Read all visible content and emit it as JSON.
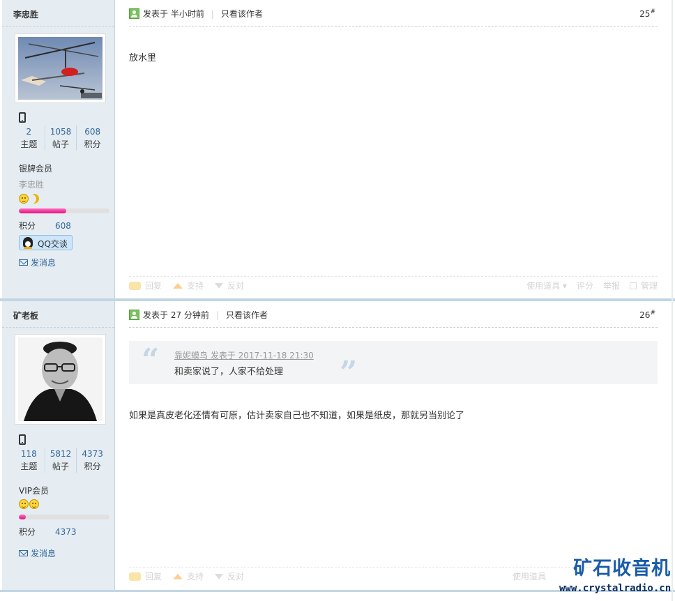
{
  "posts": [
    {
      "username": "李忠胜",
      "stats": [
        {
          "num": "2",
          "label": "主题"
        },
        {
          "num": "1058",
          "label": "帖子"
        },
        {
          "num": "608",
          "label": "积分"
        }
      ],
      "level": "银牌会员",
      "rank_name": "李忠胜",
      "points_label": "积分",
      "points_value": "608",
      "progress_fraction": 0.52,
      "qq_label": "QQ交谈",
      "message_label": "发消息",
      "posted_at": "发表于 半小时前",
      "only_author": "只看该作者",
      "floor": "25",
      "floor_mark": "#",
      "body": "放水里",
      "actions": {
        "reply": "回复",
        "support": "支持",
        "oppose": "反对",
        "tools": "使用道具",
        "rate": "评分",
        "report": "举报",
        "manage": "管理"
      }
    },
    {
      "username": "矿老板",
      "stats": [
        {
          "num": "118",
          "label": "主题"
        },
        {
          "num": "5812",
          "label": "帖子"
        },
        {
          "num": "4373",
          "label": "积分"
        }
      ],
      "level": "VIP会员",
      "points_label": "积分",
      "points_value": "4373",
      "progress_fraction": 0.08,
      "message_label": "发消息",
      "posted_at": "发表于 27 分钟前",
      "only_author": "只看该作者",
      "floor": "26",
      "floor_mark": "#",
      "quote_meta": "靠妮蟆鸟 发表于 2017-11-18 21:30",
      "quote_text": "和卖家说了，人家不给处理",
      "body": "如果是真皮老化还情有可原，估计卖家自己也不知道，如果是纸皮，那就另当别论了",
      "actions": {
        "reply": "回复",
        "support": "支持",
        "oppose": "反对",
        "tools": "使用道具"
      }
    }
  ],
  "watermark": {
    "title": "矿石收音机",
    "url": "www.crystalradio.cn"
  },
  "colors": {
    "sidebar_bg": "#e5edf2",
    "link": "#336699",
    "divider": "#c2d5e3",
    "progress": "#e0107f"
  }
}
